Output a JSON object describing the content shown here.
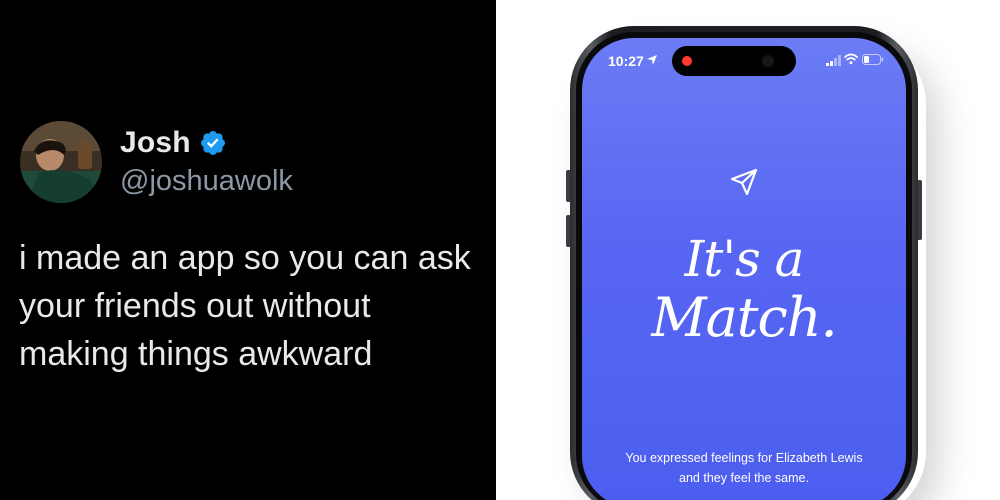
{
  "tweet": {
    "author": {
      "display_name": "Josh",
      "handle": "@joshuawolk",
      "verified": true,
      "verified_badge_color": "#1d9bf0"
    },
    "text": "i made an app so you can ask your friends out without making things awkward"
  },
  "phone": {
    "status_bar": {
      "time": "10:27"
    },
    "screen": {
      "icon": "send-icon",
      "headline_line1": "It's a",
      "headline_line2": "Match.",
      "description_line1": "You expressed feelings for Elizabeth Lewis",
      "description_line2": "and they feel the same.",
      "background_color": "#5766f2"
    }
  }
}
